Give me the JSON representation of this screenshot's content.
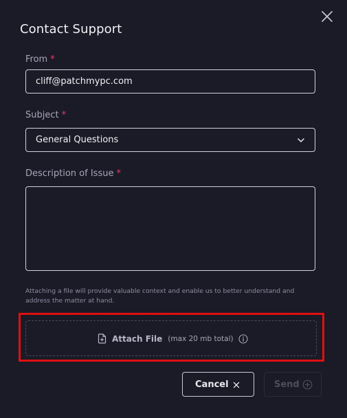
{
  "dialog": {
    "title": "Contact Support"
  },
  "form": {
    "from": {
      "label": "From",
      "required_mark": "*",
      "value": "cliff@patchmypc.com"
    },
    "subject": {
      "label": "Subject",
      "required_mark": "*",
      "selected": "General Questions"
    },
    "description": {
      "label": "Description of Issue",
      "required_mark": "*",
      "value": ""
    },
    "helper_text": "Attaching a file will provide valuable context and enable us to better understand and address the matter at hand.",
    "attach": {
      "label": "Attach File",
      "note": "(max 20 mb total)"
    }
  },
  "actions": {
    "cancel_label": "Cancel",
    "send_label": "Send"
  },
  "icons": {
    "close": "close-icon",
    "chevron": "chevron-down-icon",
    "file": "file-plus-icon",
    "info": "info-icon",
    "cancel_x": "x-icon",
    "send": "plus-circle-icon"
  },
  "colors": {
    "background": "#1b1a27",
    "required": "#e0406a",
    "highlight": "#e01010"
  }
}
